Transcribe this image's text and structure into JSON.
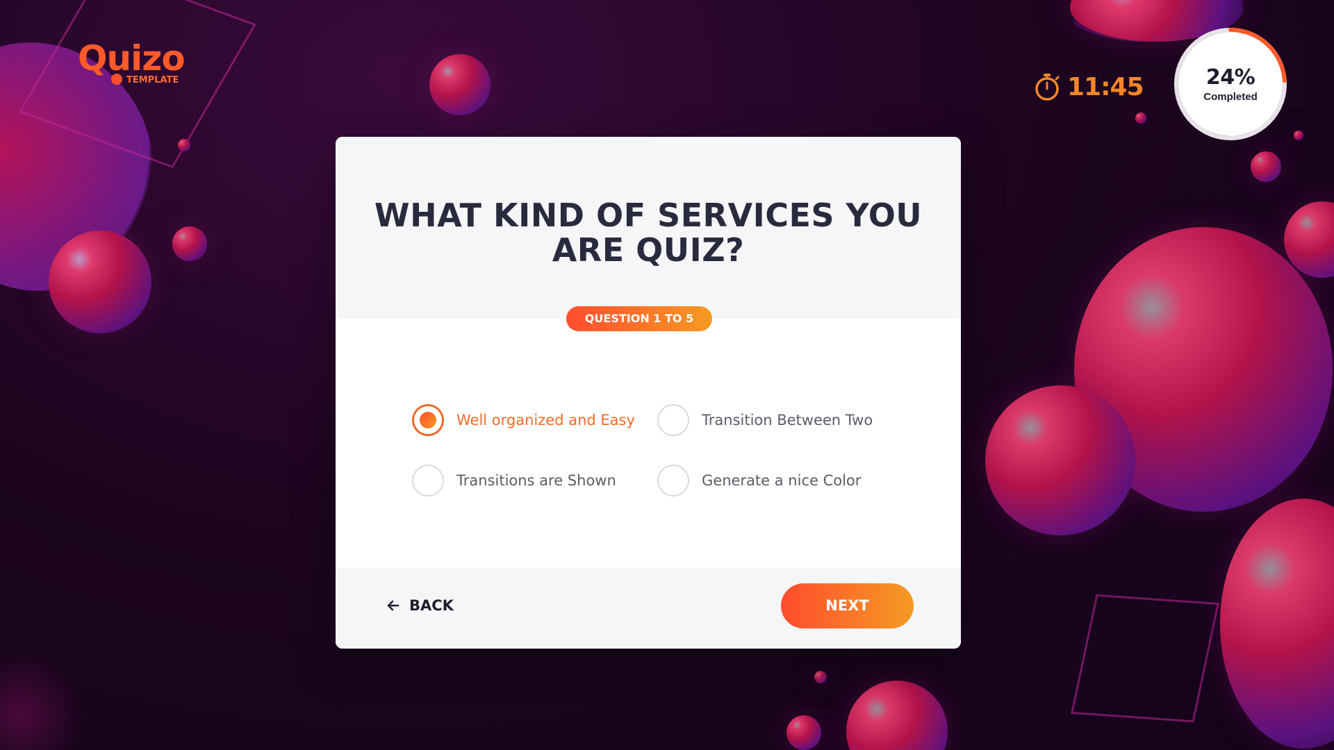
{
  "header": {
    "logo_text": "Quizo",
    "logo_subtext": "TEMPLATE",
    "timer": "11:45",
    "progress": {
      "percent_text": "24%",
      "label": "Completed",
      "value_fraction": 0.24
    }
  },
  "card": {
    "question": "WHAT KIND OF SERVICES YOU ARE QUIZ?",
    "badge": "QUESTION 1 TO 5",
    "options": [
      {
        "label": "Well organized and Easy",
        "selected": true
      },
      {
        "label": "Transition Between Two",
        "selected": false
      },
      {
        "label": "Transitions are Shown",
        "selected": false
      },
      {
        "label": "Generate a nice Color",
        "selected": false
      }
    ],
    "back_label": "BACK",
    "next_label": "NEXT"
  },
  "icons": [
    "stopwatch-icon",
    "arrow-left-icon",
    "radio-icon"
  ],
  "colors": {
    "accent_start": "#ff4d2e",
    "accent_end": "#f59a23",
    "background": "#1e0520",
    "text_dark": "#2a2a3e"
  }
}
